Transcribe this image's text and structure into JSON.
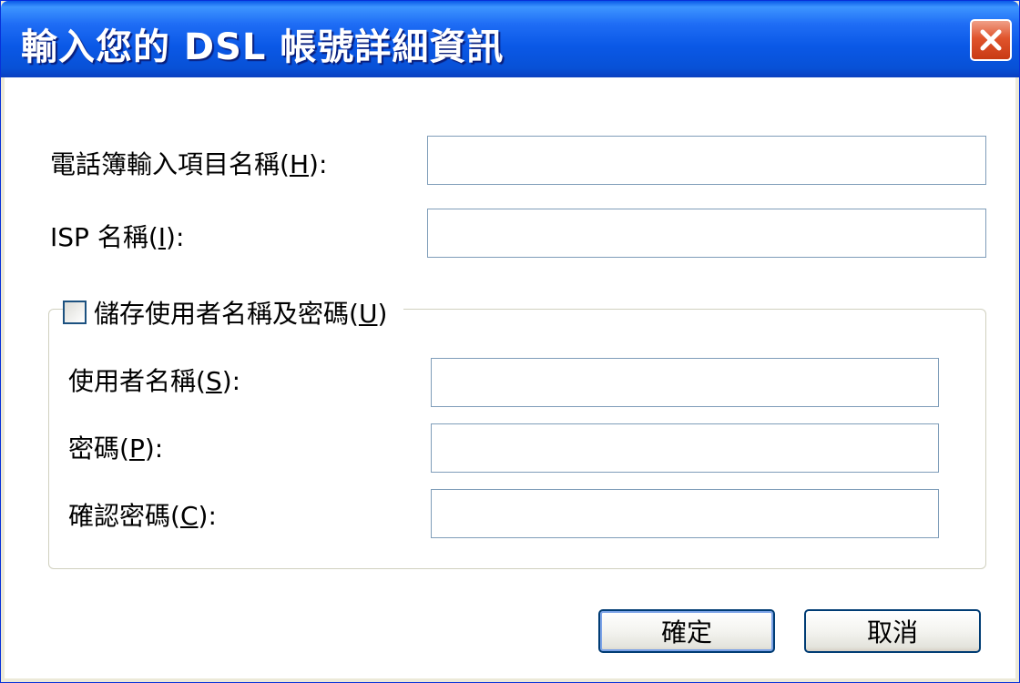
{
  "dialog": {
    "title": "輸入您的 DSL 帳號詳細資訊",
    "close_icon": "close-icon"
  },
  "fields": {
    "phonebook_label": "電話簿輸入項目名稱",
    "phonebook_mnemonic": "H",
    "phonebook_value": "",
    "isp_label": "ISP 名稱",
    "isp_mnemonic": "I",
    "isp_value": ""
  },
  "credentials": {
    "save_label": "儲存使用者名稱及密碼",
    "save_mnemonic": "U",
    "save_checked": false,
    "username_label": "使用者名稱",
    "username_mnemonic": "S",
    "username_value": "",
    "password_label": "密碼",
    "password_mnemonic": "P",
    "password_value": "",
    "confirm_label": "確認密碼",
    "confirm_mnemonic": "C",
    "confirm_value": ""
  },
  "buttons": {
    "ok_label": "確定",
    "cancel_label": "取消"
  },
  "colors": {
    "titlebar": "#0a58e6",
    "close_button": "#e0542c",
    "textbox_border": "#7f9db9",
    "button_border": "#003c74"
  }
}
